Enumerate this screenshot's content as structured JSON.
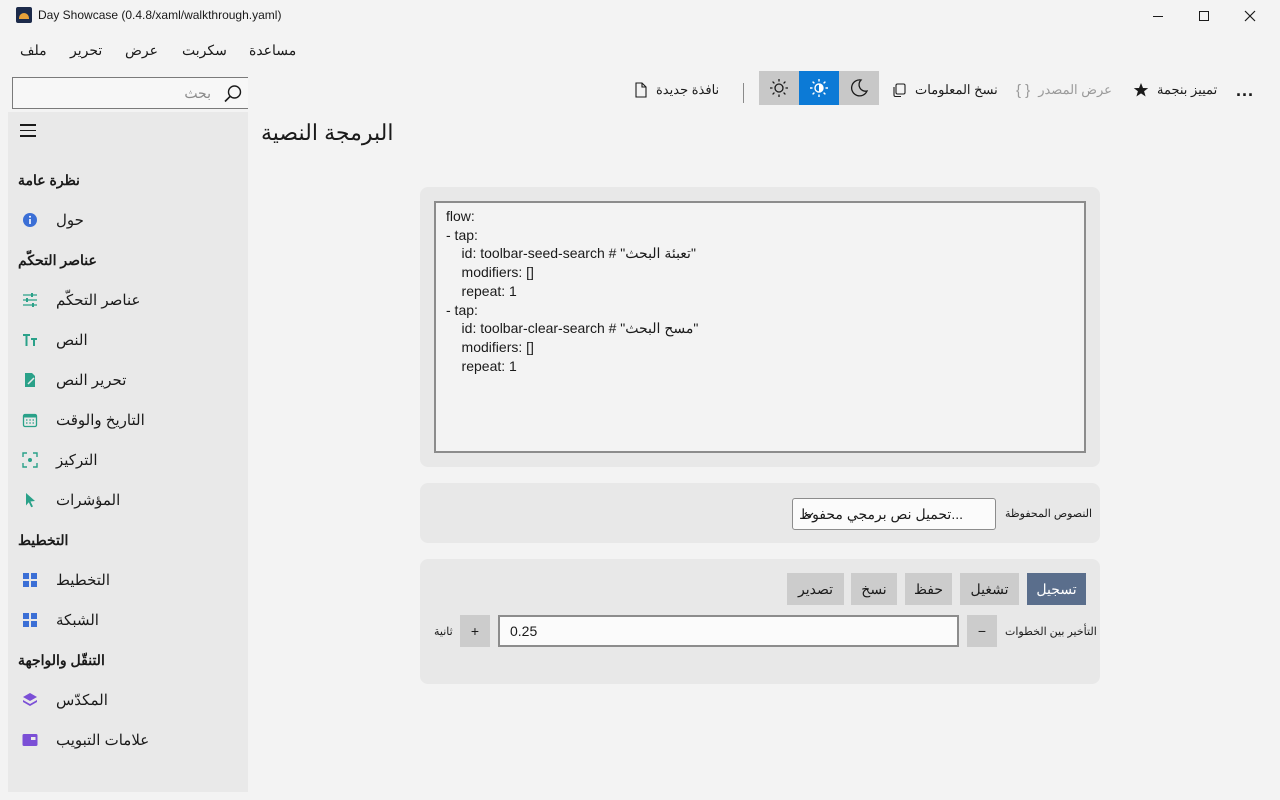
{
  "window": {
    "title": "Day Showcase (0.4.8/xaml/walkthrough.yaml)",
    "controls": [
      "minimize",
      "maximize",
      "close"
    ]
  },
  "menu": {
    "file": "ملف",
    "edit": "تحرير",
    "view": "عرض",
    "script": "سكربت",
    "help": "مساعدة"
  },
  "toolbar": {
    "search_placeholder": "بحث",
    "new_window": "نافذة جديدة",
    "copy_info": "نسخ المعلومات",
    "view_source": "عرض المصدر",
    "star": "تمييز بنجمة",
    "more": "...",
    "theme_active": "auto",
    "accent": "#0c7ad6"
  },
  "sidebar": {
    "sections": [
      {
        "header": "نظرة عامة",
        "items": [
          {
            "label": "حول",
            "icon": "info-icon"
          }
        ]
      },
      {
        "header": "عناصر التحكّم",
        "items": [
          {
            "label": "عناصر التحكّم",
            "icon": "sliders-icon"
          },
          {
            "label": "النص",
            "icon": "text-icon"
          },
          {
            "label": "تحرير النص",
            "icon": "edit-text-icon"
          },
          {
            "label": "التاريخ والوقت",
            "icon": "calendar-icon"
          },
          {
            "label": "التركيز",
            "icon": "focus-icon"
          },
          {
            "label": "المؤشرات",
            "icon": "pointer-icon"
          }
        ]
      },
      {
        "header": "التخطيط",
        "items": [
          {
            "label": "التخطيط",
            "icon": "layout-icon"
          },
          {
            "label": "الشبكة",
            "icon": "grid-icon"
          }
        ]
      },
      {
        "header": "التنقّل والواجهة",
        "items": [
          {
            "label": "المكدّس",
            "icon": "stack-icon"
          },
          {
            "label": "علامات التبويب",
            "icon": "tabs-icon"
          }
        ]
      }
    ]
  },
  "main": {
    "page_title": "البرمجة النصية",
    "script_text": "flow:\n- tap:\n    id: toolbar-seed-search # \"تعبئة البحث\"\n    modifiers: []\n    repeat: 1\n- tap:\n    id: toolbar-clear-search # \"مسح البحث\"\n    modifiers: []\n    repeat: 1",
    "saved_scripts_label": "النصوص المحفوظة",
    "saved_scripts_value": "تحميل نص برمجي محفوظ...",
    "buttons": {
      "record": "تسجيل",
      "run": "تشغيل",
      "save": "حفظ",
      "copy": "نسخ",
      "export": "تصدير"
    },
    "delay_label": "التأخير بين الخطوات",
    "delay_value": "0.25",
    "delay_unit": "ثانية",
    "minus": "−",
    "plus": "+"
  }
}
